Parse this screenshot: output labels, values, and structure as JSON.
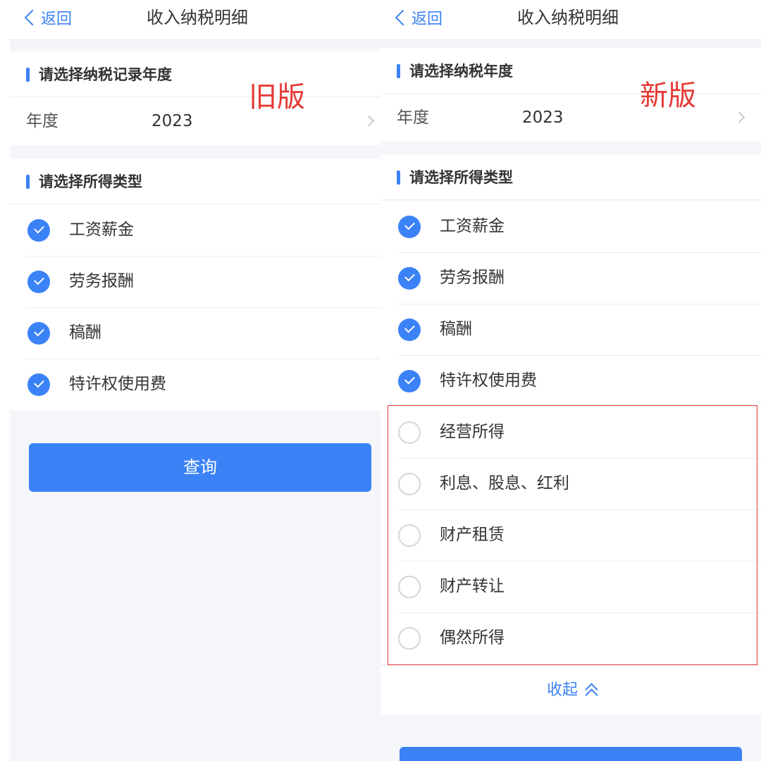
{
  "old": {
    "nav": {
      "back_label": "返回",
      "title": "收入纳税明细"
    },
    "tag": "旧版",
    "year_section": {
      "title": "请选择纳税记录年度",
      "year_label": "年度",
      "year_value": "2023"
    },
    "income_section": {
      "title": "请选择所得类型"
    },
    "options": [
      {
        "label": "工资薪金",
        "checked": true
      },
      {
        "label": "劳务报酬",
        "checked": true
      },
      {
        "label": "稿酬",
        "checked": true
      },
      {
        "label": "特许权使用费",
        "checked": true
      }
    ],
    "query_label": "查询"
  },
  "new": {
    "nav": {
      "back_label": "返回",
      "title": "收入纳税明细"
    },
    "tag": "新版",
    "year_section": {
      "title": "请选择纳税年度",
      "year_label": "年度",
      "year_value": "2023"
    },
    "income_section": {
      "title": "请选择所得类型"
    },
    "options": [
      {
        "label": "工资薪金",
        "checked": true
      },
      {
        "label": "劳务报酬",
        "checked": true
      },
      {
        "label": "稿酬",
        "checked": true
      },
      {
        "label": "特许权使用费",
        "checked": true
      },
      {
        "label": "经营所得",
        "checked": false
      },
      {
        "label": "利息、股息、红利",
        "checked": false
      },
      {
        "label": "财产租赁",
        "checked": false
      },
      {
        "label": "财产转让",
        "checked": false
      },
      {
        "label": "偶然所得",
        "checked": false
      }
    ],
    "collapse_label": "收起"
  },
  "colors": {
    "accent": "#3b82f6",
    "highlight": "#e53935",
    "background": "#f4f6fa"
  }
}
